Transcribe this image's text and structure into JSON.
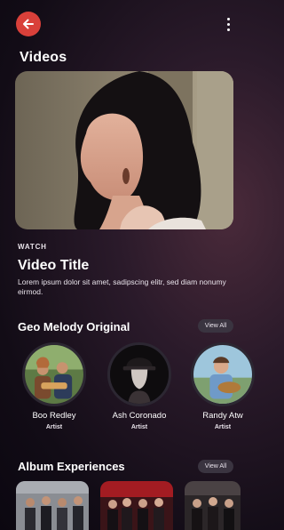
{
  "header": {
    "title": "Videos"
  },
  "featured": {
    "eyebrow": "WATCH",
    "title": "Video Title",
    "description": "Lorem ipsum dolor sit amet, sadipscing elitr, sed diam nonumy eirmod."
  },
  "artists_section": {
    "title": "Geo Melody Original",
    "view_all": "View All",
    "items": [
      {
        "name": "Boo Redley",
        "role": "Artist"
      },
      {
        "name": "Ash Coronado",
        "role": "Artist"
      },
      {
        "name": "Randy Atw",
        "role": "Artist"
      }
    ]
  },
  "albums_section": {
    "title": "Album Experiences",
    "view_all": "View All"
  },
  "colors": {
    "accent": "#d9403a",
    "background": "#120c16",
    "pill": "#3a3440"
  },
  "icons": [
    "back-arrow-icon",
    "more-vertical-icon"
  ]
}
